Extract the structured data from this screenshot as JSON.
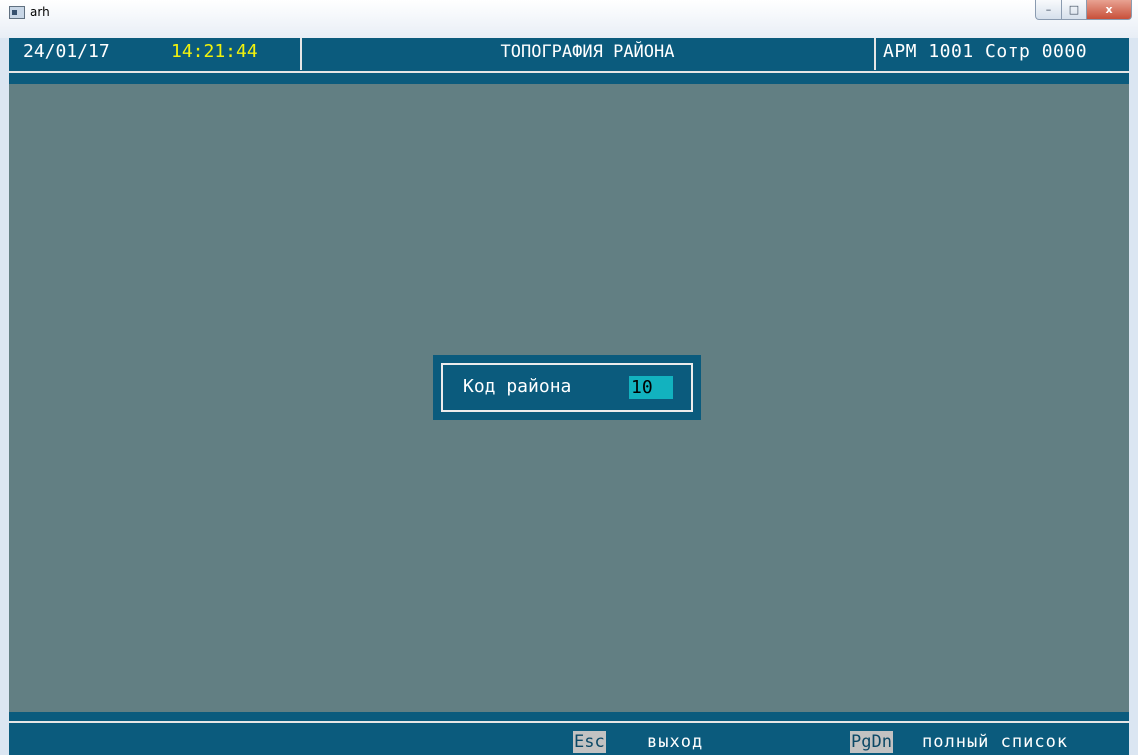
{
  "window": {
    "title": "arh",
    "minimize": "–",
    "maximize": "□",
    "close": "x"
  },
  "header": {
    "date": "24/01/17",
    "time": "14:21:44",
    "title": "ТОПОГРАФИЯ РАЙОНА",
    "right": "АРМ 1001 Сотр 0000"
  },
  "dialog": {
    "label": "Код района",
    "value": "10"
  },
  "footer": {
    "keys": [
      {
        "key": "Esc",
        "label": "выход"
      },
      {
        "key": "PgDn",
        "label": "полный список"
      }
    ]
  },
  "colors": {
    "background": "#627f83",
    "header_bg": "#0b5b7d",
    "time_color": "#f2f20c",
    "field_bg": "#12b2bf",
    "key_bg": "#c2c2c2"
  },
  "icons": {
    "app": "console-window-icon"
  }
}
